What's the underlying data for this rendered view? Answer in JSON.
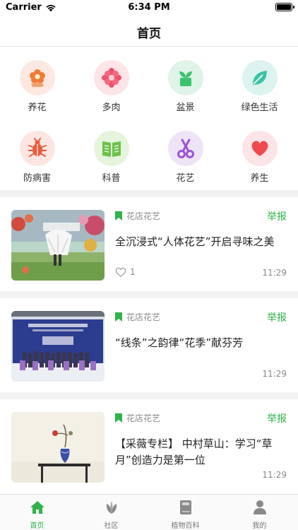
{
  "status_bar": {
    "carrier": "Carrier",
    "time": "6:34 PM"
  },
  "nav": {
    "title": "首页"
  },
  "categories": [
    {
      "label": "养花",
      "icon": "flower-icon",
      "bg": "#fde9e1",
      "color": "#f07c3c"
    },
    {
      "label": "多肉",
      "icon": "succulent-icon",
      "bg": "#fde4e7",
      "color": "#f0506a"
    },
    {
      "label": "盆景",
      "icon": "potted-plant-icon",
      "bg": "#dff3e8",
      "color": "#3cc26e"
    },
    {
      "label": "绿色生活",
      "icon": "leaf-icon",
      "bg": "#dcf3ef",
      "color": "#3cc2a4"
    },
    {
      "label": "防病害",
      "icon": "bug-icon",
      "bg": "#fde6e1",
      "color": "#ef5a3c"
    },
    {
      "label": "科普",
      "icon": "book-icon",
      "bg": "#e6f4dc",
      "color": "#6cc24a"
    },
    {
      "label": "花艺",
      "icon": "scissors-icon",
      "bg": "#efe4f7",
      "color": "#9a55d6"
    },
    {
      "label": "养生",
      "icon": "heart-icon",
      "bg": "#fde4e6",
      "color": "#ef4a4f"
    }
  ],
  "articles": [
    {
      "tag": "花店花艺",
      "report": "举报",
      "title": "全沉浸式“人体花艺”开启寻味之美",
      "likes": "1",
      "time": "11:29"
    },
    {
      "tag": "花店花艺",
      "report": "举报",
      "title": "“线条”之韵律“花季”献芬芳",
      "likes": "",
      "time": "11:29"
    },
    {
      "tag": "花店花艺",
      "report": "举报",
      "title": "【采薇专栏】 中村草山：学习“草月”创造力是第一位",
      "likes": "",
      "time": "11:29"
    }
  ],
  "tabs": [
    {
      "label": "首页",
      "icon": "home-icon",
      "active": true
    },
    {
      "label": "社区",
      "icon": "community-leaf-icon",
      "active": false
    },
    {
      "label": "植物百科",
      "icon": "encyclopedia-book-icon",
      "active": false
    },
    {
      "label": "我的",
      "icon": "profile-icon",
      "active": false
    }
  ],
  "colors": {
    "accent": "#2fb34a",
    "tab_inactive": "#777777",
    "divider": "#f2f2f2"
  }
}
